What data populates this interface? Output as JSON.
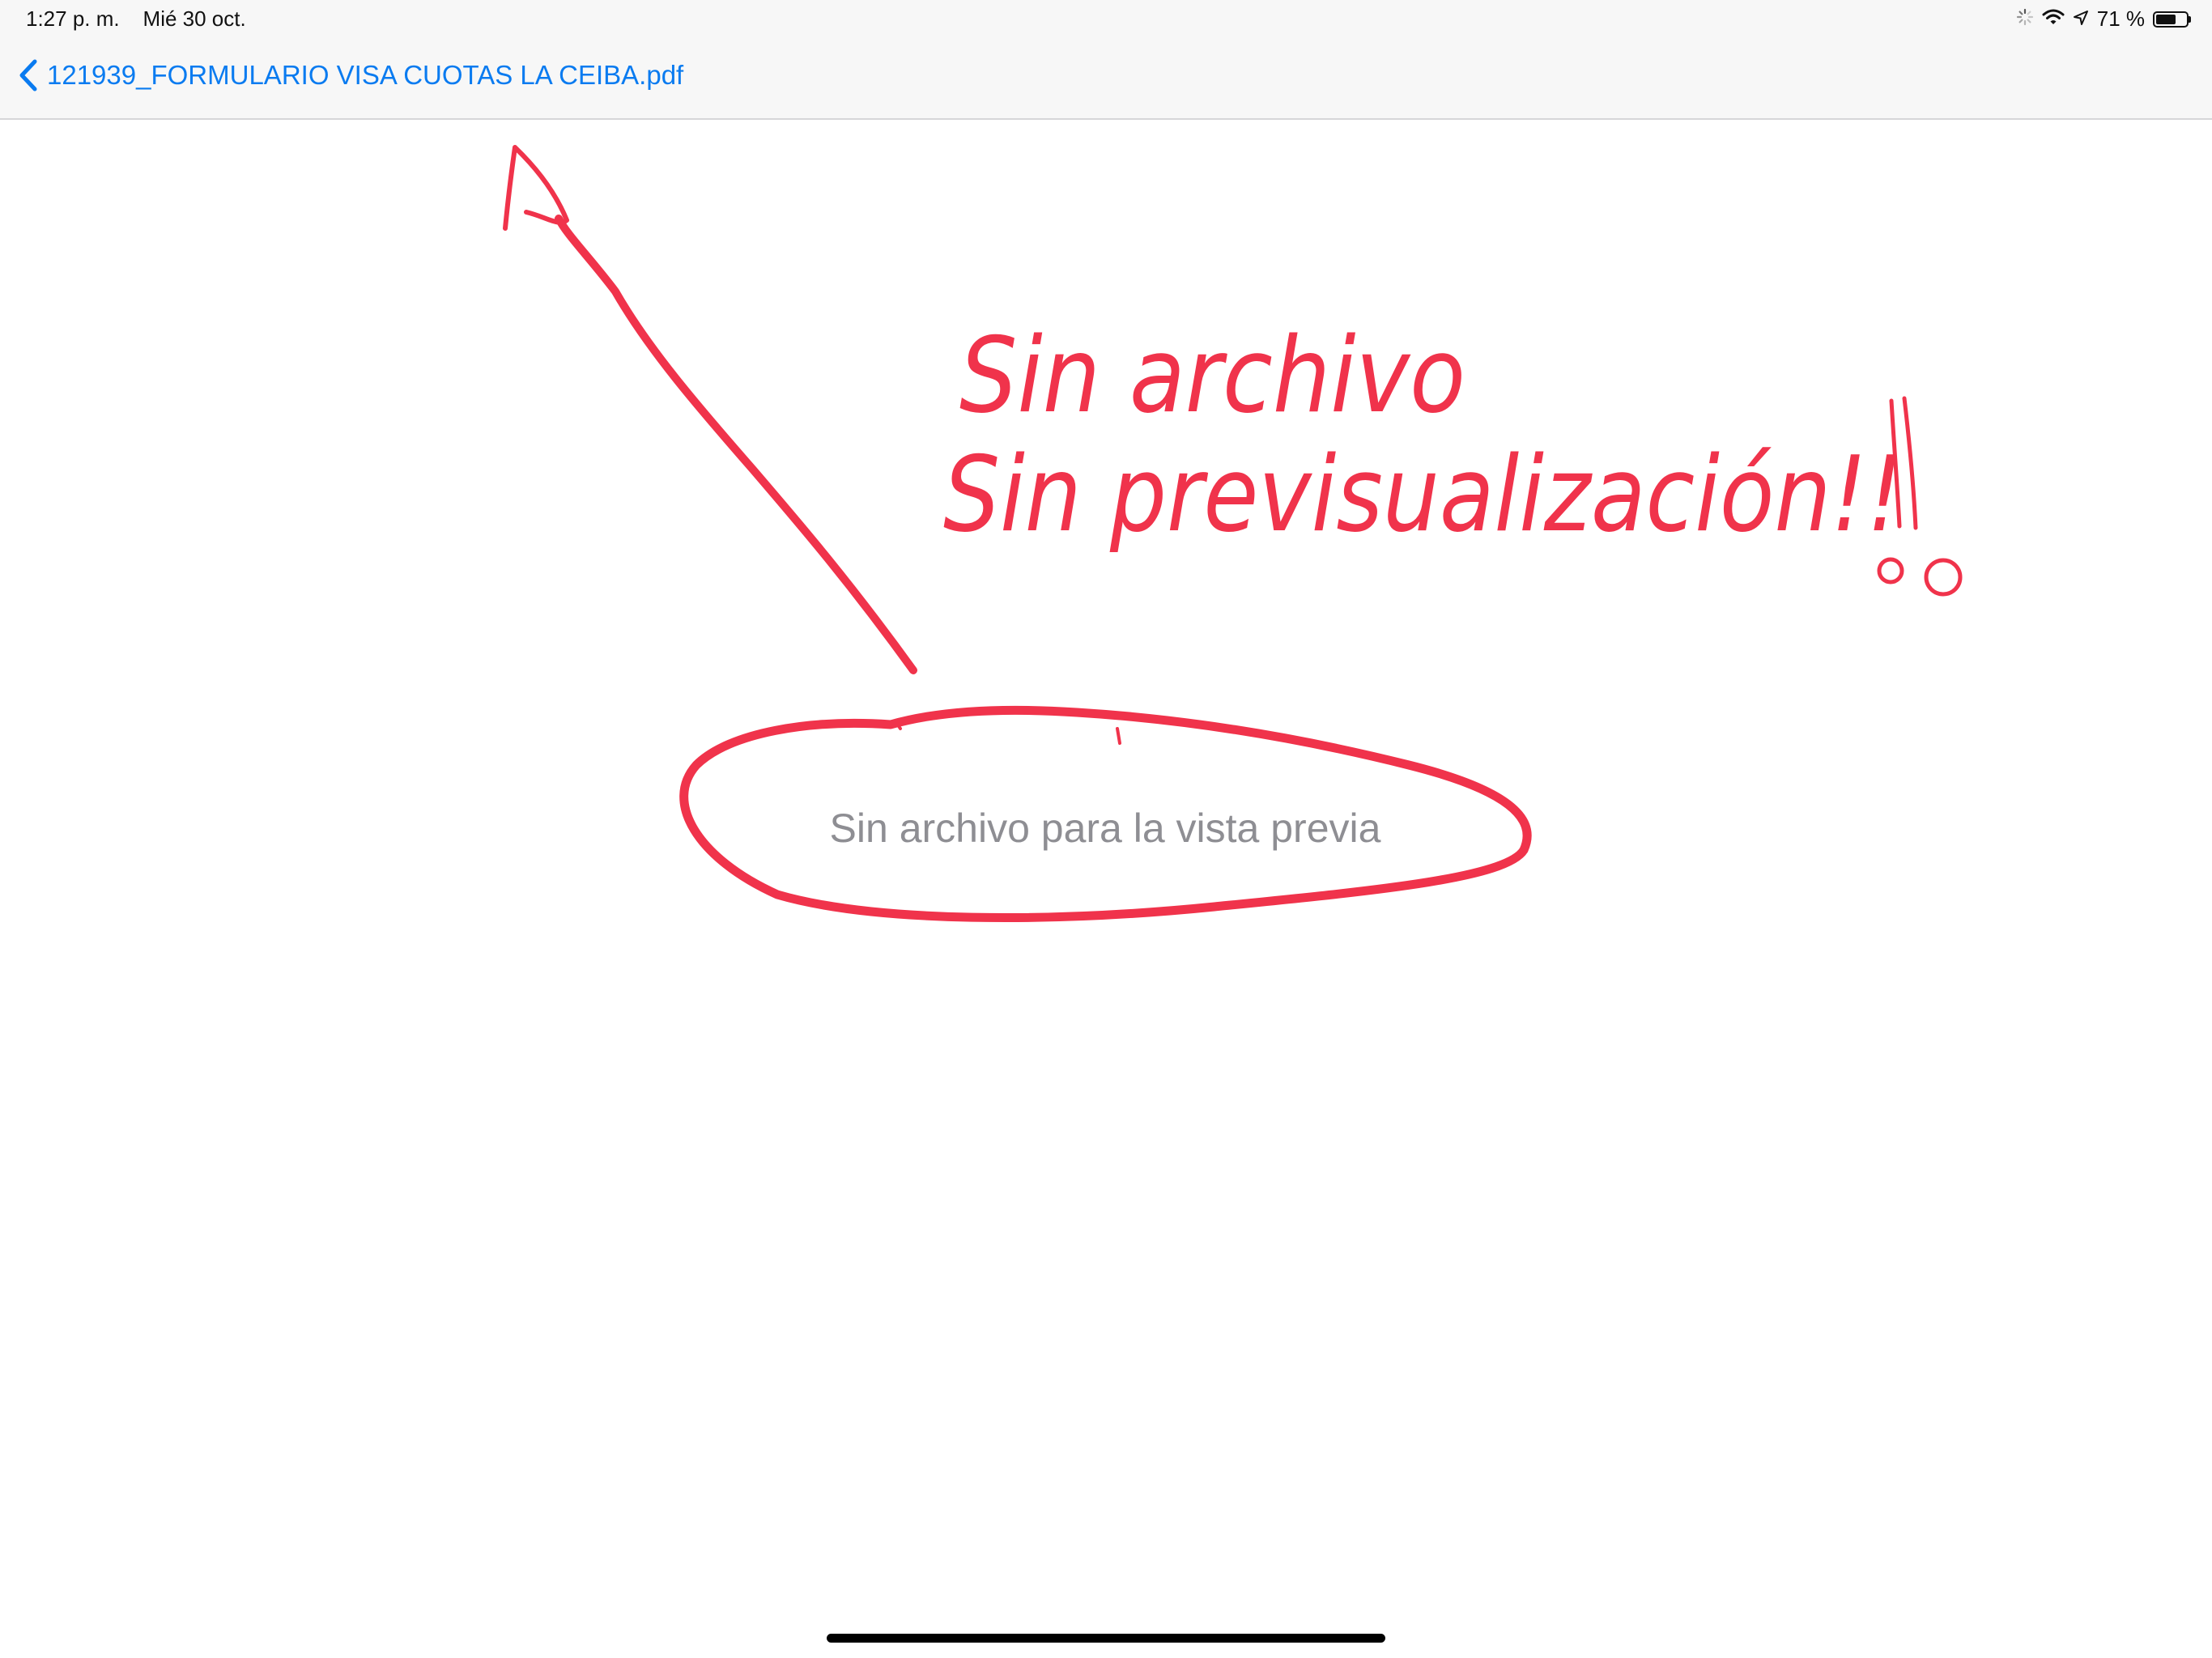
{
  "status_bar": {
    "time": "1:27 p. m.",
    "date": "Mié 30 oct.",
    "battery_text": "71 %",
    "battery_level": 0.71,
    "icons": [
      "activity-spinner-icon",
      "wifi-icon",
      "location-arrow-icon",
      "battery-icon"
    ]
  },
  "nav": {
    "back_label": "121939_FORMULARIO VISA CUOTAS LA CEIBA.pdf",
    "back_icon": "chevron-left-icon",
    "accent_color": "#0a7bf0"
  },
  "content": {
    "empty_message": "Sin archivo para la vista previa"
  },
  "annotation": {
    "color": "#f0334b",
    "line1": "Sin archivo",
    "line2": "Sin previsualización!!"
  }
}
